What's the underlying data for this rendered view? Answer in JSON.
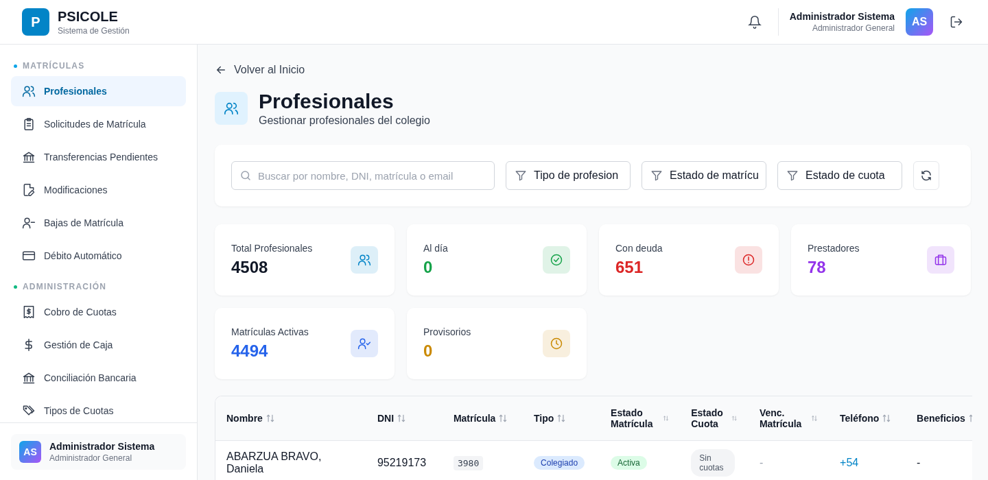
{
  "brand": {
    "logo_letter": "P",
    "name": "PSICOLE",
    "subtitle": "Sistema de Gestión"
  },
  "header": {
    "user_name": "Administrador Sistema",
    "user_role": "Administrador General",
    "avatar": "AS"
  },
  "sidebar": {
    "sections": [
      {
        "title": "MATRÍCULAS",
        "color": "#0ea5e9",
        "items": [
          {
            "label": "Profesionales",
            "selected": true
          },
          {
            "label": "Solicitudes de Matrícula",
            "selected": false
          },
          {
            "label": "Transferencias Pendientes",
            "selected": false
          },
          {
            "label": "Modificaciones",
            "selected": false
          },
          {
            "label": "Bajas de Matrícula",
            "selected": false
          },
          {
            "label": "Débito Automático",
            "selected": false
          }
        ]
      },
      {
        "title": "ADMINISTRACIÓN",
        "color": "#10b981",
        "items": [
          {
            "label": "Cobro de Cuotas",
            "selected": false
          },
          {
            "label": "Gestión de Caja",
            "selected": false
          },
          {
            "label": "Conciliación Bancaria",
            "selected": false
          },
          {
            "label": "Tipos de Cuotas",
            "selected": false
          }
        ]
      }
    ],
    "footer": {
      "avatar": "AS",
      "name": "Administrador Sistema",
      "role": "Administrador General"
    }
  },
  "back_link": "Volver al Inicio",
  "page": {
    "title": "Profesionales",
    "subtitle": "Gestionar profesionales del colegio"
  },
  "filters": {
    "search_placeholder": "Buscar por nombre, DNI, matrícula o email",
    "dropdowns": [
      "Tipo de profesion",
      "Estado de matrícu",
      "Estado de cuota"
    ]
  },
  "stats": [
    {
      "label": "Total Profesionales",
      "value": "4508",
      "color": "#111827"
    },
    {
      "label": "Al día",
      "value": "0",
      "color": "#16a34a"
    },
    {
      "label": "Con deuda",
      "value": "651",
      "color": "#dc2626"
    },
    {
      "label": "Prestadores",
      "value": "78",
      "color": "#9333ea"
    },
    {
      "label": "Matrículas Activas",
      "value": "4494",
      "color": "#2563eb"
    },
    {
      "label": "Provisorios",
      "value": "0",
      "color": "#ca8a04"
    }
  ],
  "table": {
    "columns": [
      "Nombre",
      "DNI",
      "Matrícula",
      "Tipo",
      "Estado Matrícula",
      "Estado Cuota",
      "Venc. Matrícula",
      "Teléfono",
      "Beneficios"
    ],
    "rows": [
      {
        "nombre": "ABARZUA BRAVO, Daniela",
        "dni": "95219173",
        "matricula": "3980",
        "tipo": "Colegiado",
        "estado_matricula": "Activa",
        "estado_cuota": "Sin cuotas",
        "vencimiento": "-",
        "telefono": "+54",
        "beneficios": "-"
      }
    ]
  }
}
